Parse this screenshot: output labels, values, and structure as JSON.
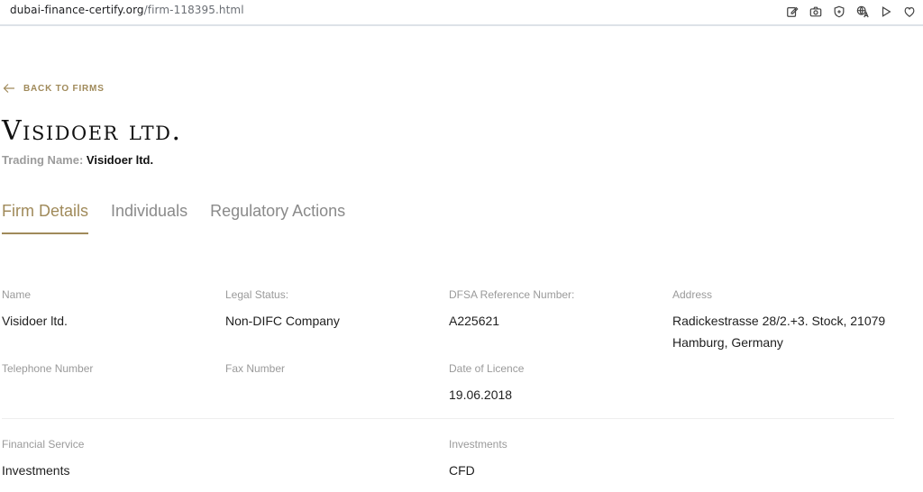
{
  "browser": {
    "url_domain": "dubai-finance-certify.org",
    "url_path": "/firm-118395.html",
    "toolbar_icons": [
      "edit-icon",
      "camera-icon",
      "shield-icon",
      "translate-icon",
      "play-icon",
      "heart-icon"
    ]
  },
  "page": {
    "back_label": "BACK TO FIRMS",
    "firm_title": "Visidoer ltd.",
    "trading_label": "Trading Name:",
    "trading_value": "Visidoer ltd."
  },
  "tabs": [
    {
      "label": "Firm Details",
      "active": true
    },
    {
      "label": "Individuals",
      "active": false
    },
    {
      "label": "Regulatory Actions",
      "active": false
    }
  ],
  "fields": {
    "name": {
      "label": "Name",
      "value": "Visidoer ltd."
    },
    "legal_status": {
      "label": "Legal Status:",
      "value": "Non-DIFC Company"
    },
    "dfsa_ref": {
      "label": "DFSA Reference Number:",
      "value": "A225621"
    },
    "address": {
      "label": "Address",
      "line1": "Radickestrasse 28/2.+3. Stock, 21079",
      "line2": "Hamburg, Germany"
    },
    "telephone": {
      "label": "Telephone Number",
      "value": ""
    },
    "fax": {
      "label": "Fax Number",
      "value": ""
    },
    "licence_date": {
      "label": "Date of Licence",
      "value": "19.06.2018"
    },
    "financial_service": {
      "label": "Financial Service",
      "value": "Investments"
    },
    "investments": {
      "label": "Investments",
      "value": "CFD"
    }
  },
  "colors": {
    "accent": "#a08a5a",
    "label_gray": "#9a9a9a",
    "text": "#1f1f1f"
  }
}
